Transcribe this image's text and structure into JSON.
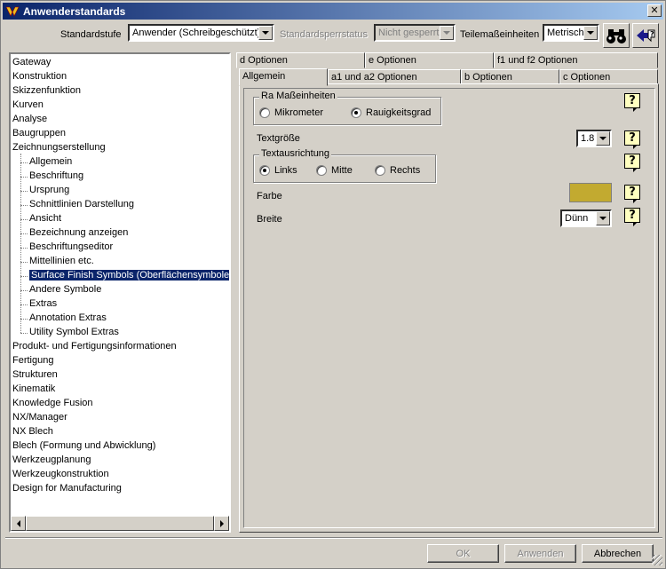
{
  "window": {
    "title": "Anwenderstandards",
    "close_glyph": "✕"
  },
  "toolbar": {
    "standardstufe_label": "Standardstufe",
    "standardstufe_value": "Anwender (Schreibgeschützt)",
    "sperrstatus_label": "Standardsperrstatus",
    "sperrstatus_value": "Nicht gesperrt",
    "teilemass_label": "Teilemaßeinheiten",
    "teilemass_value": "Metrisch"
  },
  "tree": {
    "items": [
      {
        "label": "Gateway",
        "level": 0
      },
      {
        "label": "Konstruktion",
        "level": 0
      },
      {
        "label": "Skizzenfunktion",
        "level": 0
      },
      {
        "label": "Kurven",
        "level": 0
      },
      {
        "label": "Analyse",
        "level": 0
      },
      {
        "label": "Baugruppen",
        "level": 0
      },
      {
        "label": "Zeichnungserstellung",
        "level": 0
      },
      {
        "label": "Allgemein",
        "level": 1
      },
      {
        "label": "Beschriftung",
        "level": 1
      },
      {
        "label": "Ursprung",
        "level": 1
      },
      {
        "label": "Schnittlinien Darstellung",
        "level": 1
      },
      {
        "label": "Ansicht",
        "level": 1
      },
      {
        "label": "Bezeichnung anzeigen",
        "level": 1
      },
      {
        "label": "Beschriftungseditor",
        "level": 1
      },
      {
        "label": "Mittellinien etc.",
        "level": 1
      },
      {
        "label": "Surface Finish Symbols (Oberflächensymbole)",
        "level": 1,
        "selected": true
      },
      {
        "label": "Andere Symbole",
        "level": 1
      },
      {
        "label": "Extras",
        "level": 1
      },
      {
        "label": "Annotation Extras",
        "level": 1
      },
      {
        "label": "Utility Symbol Extras",
        "level": 1
      },
      {
        "label": "Produkt- und Fertigungsinformationen",
        "level": 0
      },
      {
        "label": "Fertigung",
        "level": 0
      },
      {
        "label": "Strukturen",
        "level": 0
      },
      {
        "label": "Kinematik",
        "level": 0
      },
      {
        "label": "Knowledge Fusion",
        "level": 0
      },
      {
        "label": "NX/Manager",
        "level": 0
      },
      {
        "label": "NX Blech",
        "level": 0
      },
      {
        "label": "Blech (Formung und Abwicklung)",
        "level": 0
      },
      {
        "label": "Werkzeugplanung",
        "level": 0
      },
      {
        "label": "Werkzeugkonstruktion",
        "level": 0
      },
      {
        "label": "Design for Manufacturing",
        "level": 0
      }
    ]
  },
  "tabs": {
    "row1": [
      "d Optionen",
      "e Optionen",
      "f1 und f2 Optionen"
    ],
    "row2": [
      "Allgemein",
      "a1 und a2 Optionen",
      "b Optionen",
      "c Optionen"
    ],
    "active": "Allgemein"
  },
  "panel": {
    "ra_group": {
      "legend": "Ra Maßeinheiten",
      "options": [
        "Mikrometer",
        "Rauigkeitsgrad"
      ],
      "selected": "Rauigkeitsgrad"
    },
    "textgroesse": {
      "label": "Textgröße",
      "value": "1.8"
    },
    "textausrichtung": {
      "legend": "Textausrichtung",
      "options": [
        "Links",
        "Mitte",
        "Rechts"
      ],
      "selected": "Links"
    },
    "farbe": {
      "label": "Farbe",
      "color": "#c2aa30"
    },
    "breite": {
      "label": "Breite",
      "value": "Dünn"
    },
    "help_glyph": "?"
  },
  "buttons": {
    "ok": "OK",
    "anwenden": "Anwenden",
    "abbrechen": "Abbrechen"
  }
}
